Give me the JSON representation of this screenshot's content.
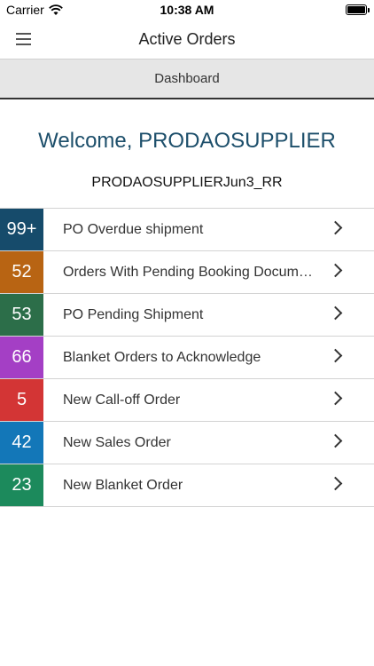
{
  "status_bar": {
    "carrier": "Carrier",
    "time": "10:38 AM"
  },
  "nav": {
    "title": "Active Orders",
    "menu_icon": "hamburger-menu-icon"
  },
  "dashboard": {
    "label": "Dashboard"
  },
  "welcome": {
    "greeting": "Welcome, PRODAOSUPPLIER",
    "account": "PRODAOSUPPLIERJun3_RR"
  },
  "orders": [
    {
      "count": "99+",
      "label": "PO Overdue shipment",
      "color": "#164b6b"
    },
    {
      "count": "52",
      "label": "Orders With Pending Booking Documents",
      "color": "#b86413"
    },
    {
      "count": "53",
      "label": "PO Pending Shipment",
      "color": "#2c6e49"
    },
    {
      "count": "66",
      "label": "Blanket Orders to Acknowledge",
      "color": "#a43fc5"
    },
    {
      "count": "5",
      "label": "New Call-off Order",
      "color": "#d33535"
    },
    {
      "count": "42",
      "label": "New Sales Order",
      "color": "#1377b8"
    },
    {
      "count": "23",
      "label": "New Blanket Order",
      "color": "#1c8a5c"
    }
  ],
  "colors": {
    "welcome_text": "#1d4f6b",
    "dashboard_bg": "#e6e6e6"
  }
}
